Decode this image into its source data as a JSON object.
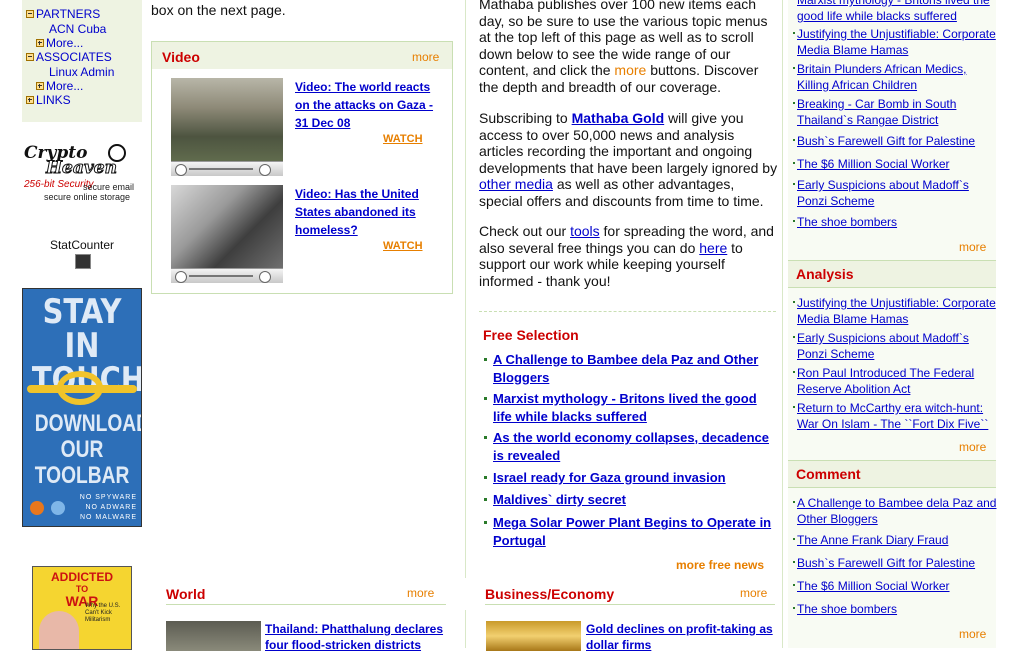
{
  "sidebar": {
    "items": [
      {
        "label": "PARTNERS",
        "icon": "collapse-box-icon"
      },
      {
        "label": "ACN Cuba"
      },
      {
        "label": "More...",
        "icon": "expand-box-icon"
      },
      {
        "label": "ASSOCIATES",
        "icon": "collapse-box-icon"
      },
      {
        "label": "Linux Admin"
      },
      {
        "label": "More...",
        "icon": "expand-box-icon"
      },
      {
        "label": "LINKS",
        "icon": "expand-box-icon"
      }
    ],
    "crypto": {
      "title1": "Crypto",
      "title2": "Heaven",
      "security": "256-bit Security",
      "line1": "secure email",
      "line2": "secure online storage"
    },
    "statcounter": "StatCounter",
    "toolbar_ad": {
      "line1": "STAY IN",
      "line2": "TOUCH",
      "line3": "DOWNLOAD",
      "line4": "OUR",
      "line5": "TOOLBAR",
      "note1": "NO SPYWARE",
      "note2": "NO ADWARE",
      "note3": "NO MALWARE"
    },
    "book": {
      "line1": "ADDICTED",
      "line2": "TO",
      "line3": "WAR",
      "sub": "Why the U.S. Can't Kick Militarism"
    }
  },
  "top_text": "box on the next page.",
  "video": {
    "title": "Video",
    "more": "more",
    "items": [
      {
        "title": "Video: The world reacts on the attacks on Gaza - 31 Dec 08",
        "watch": "WATCH"
      },
      {
        "title": "Video: Has the United States abandoned its homeless?",
        "watch": "WATCH"
      }
    ]
  },
  "intro": {
    "p1": "Mathaba publishes over 100 new items each day, so be sure to use the various topic menus at the top left of this page as well as to scroll down below to see the wide range of our content, and click the",
    "p1_more": "more",
    "p1_end": "buttons. Discover the depth and breadth of our coverage.",
    "p2_start": "Subscribing to",
    "p2_link": "Mathaba Gold",
    "p2_mid": "will give you access to over 50,000 news and analysis articles recording the important and ongoing developments that have been largely ignored by",
    "p2_link2": "other media",
    "p2_end": "as well as other advantages, special offers and discounts from time to time.",
    "p3_start": "Check out our",
    "p3_link": "tools",
    "p3_mid": "for spreading the word, and also several free things you can do",
    "p3_link2": "here",
    "p3_end": "to support our work while keeping yourself informed - thank you!"
  },
  "free_selection": {
    "title": "Free Selection",
    "items": [
      "A Challenge to Bambee dela Paz and Other Bloggers",
      "Marxist mythology - Britons lived the good life while blacks suffered",
      "As the world economy collapses, decadence is revealed",
      "Israel ready for Gaza ground invasion",
      "Maldives` dirty secret",
      "Mega Solar Power Plant Begins to Operate in Portugal"
    ],
    "more": "more free news"
  },
  "world": {
    "title": "World",
    "more": "more",
    "headline": "Thailand: Phatthalung declares four flood-stricken districts"
  },
  "business": {
    "title": "Business/Economy",
    "more": "more",
    "headline": "Gold declines on profit-taking as dollar firms"
  },
  "right": {
    "top_links": [
      "Marxist mythology - Britons lived the good life while blacks suffered",
      "Justifying the Unjustifiable: Corporate Media Blame Hamas",
      "Britain Plunders African Medics, Killing African Children",
      "Breaking - Car Bomb in South Thailand`s Rangae District",
      "Bush`s Farewell Gift for Palestine",
      "The $6 Million Social Worker",
      "Early Suspicions about Madoff`s Ponzi Scheme",
      "The shoe bombers"
    ],
    "top_more": "more",
    "analysis": {
      "title": "Analysis",
      "links": [
        "Justifying the Unjustifiable: Corporate Media Blame Hamas",
        "Early Suspicions about Madoff`s Ponzi Scheme",
        "Ron Paul Introduced The Federal Reserve Abolition Act",
        "Return to McCarthy era witch-hunt: War On Islam - The ``Fort Dix Five``"
      ],
      "more": "more"
    },
    "comment": {
      "title": "Comment",
      "links": [
        "A Challenge to Bambee dela Paz and Other Bloggers",
        "The Anne Frank Diary Fraud",
        "Bush`s Farewell Gift for Palestine",
        "The $6 Million Social Worker",
        "The shoe bombers"
      ],
      "more": "more"
    }
  }
}
